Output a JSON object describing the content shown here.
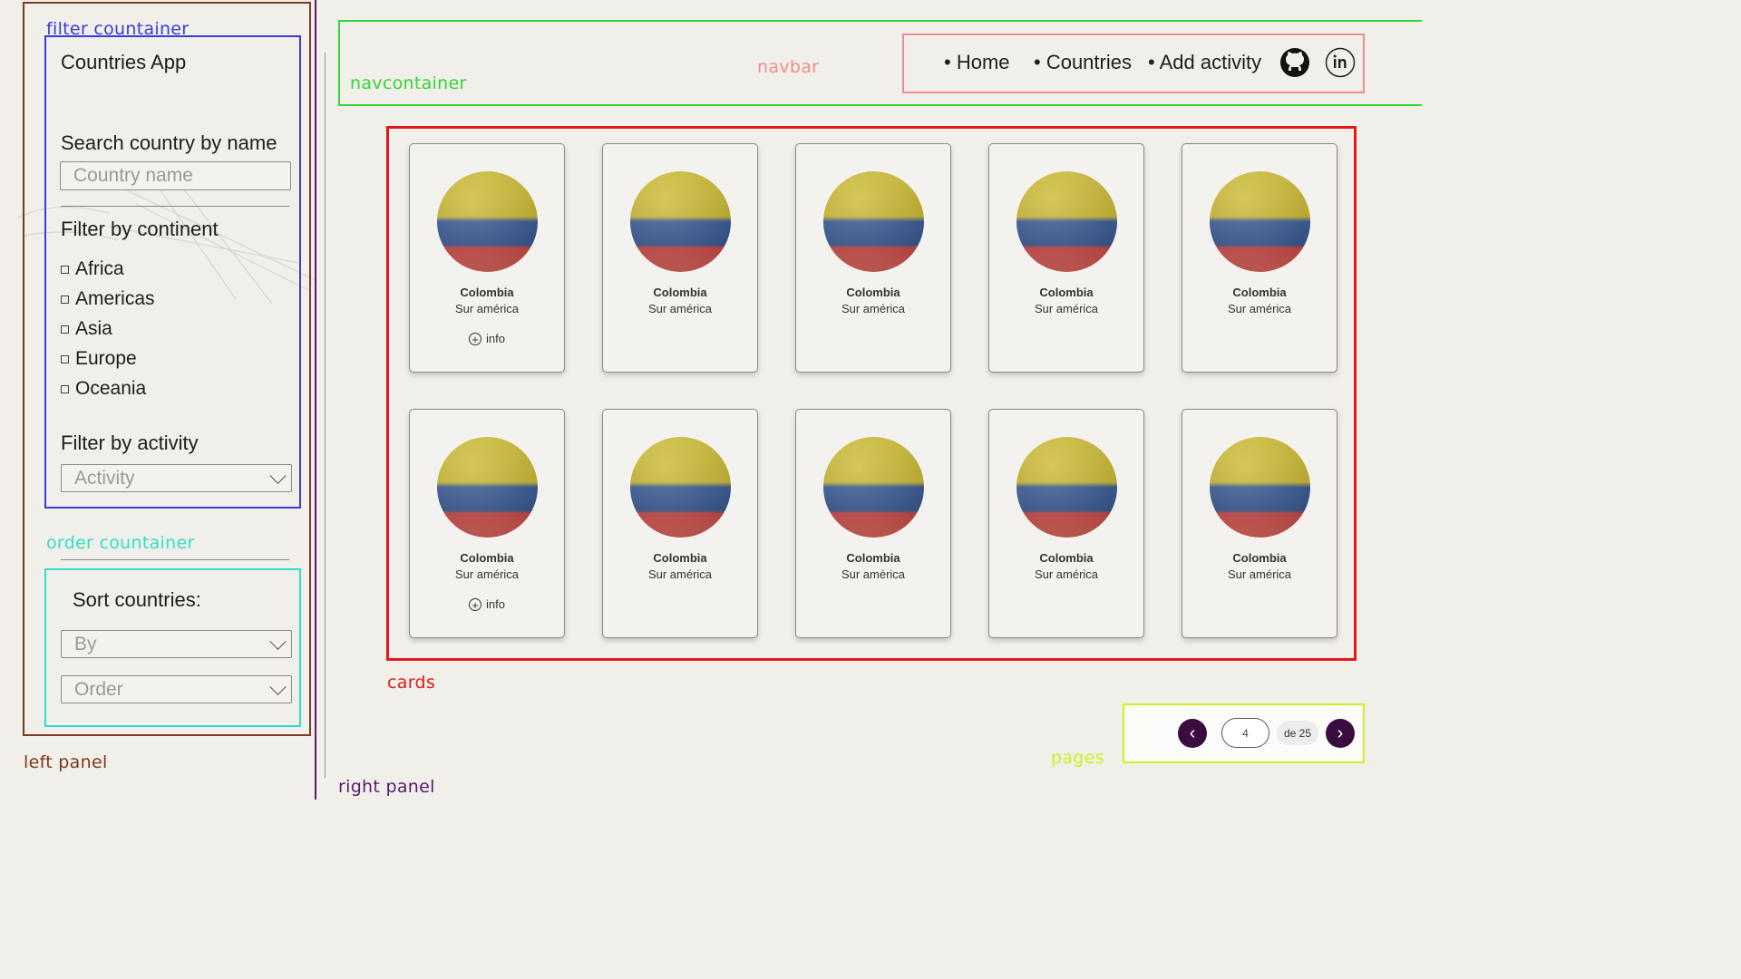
{
  "annotations": {
    "filter_container": "filter countainer",
    "navcontainer": "navcontainer",
    "navbar": "navbar",
    "order_container": "order countainer",
    "cards": "cards",
    "pages": "pages",
    "left_panel": "left panel",
    "right_panel": "right panel"
  },
  "colors": {
    "left_panel": "#7c3a1e",
    "filter_container": "#3b3bd6",
    "order_container": "#2fe0c8",
    "navcontainer": "#33d633",
    "navbar": "#f28c8c",
    "cards": "#e31818",
    "pages": "#d2ee1e",
    "right_panel": "#5a1a6e",
    "page_button": "#3a0c3f"
  },
  "sidebar": {
    "app_title": "Countries App",
    "search_label": "Search country by name",
    "search_placeholder": "Country name",
    "continent_label": "Filter by continent",
    "continents": [
      "Africa",
      "Americas",
      "Asia",
      "Europe",
      "Oceania"
    ],
    "activity_label": "Filter by activity",
    "activity_placeholder": "Activity",
    "sort_label": "Sort countries:",
    "sort_by_placeholder": "By",
    "sort_order_placeholder": "Order"
  },
  "navbar": {
    "items": [
      "Home",
      "Countries",
      "Add activity"
    ],
    "icons": [
      "github-icon",
      "linkedin-icon"
    ]
  },
  "cards": [
    {
      "name": "Colombia",
      "region": "Sur américa",
      "info": "info"
    },
    {
      "name": "Colombia",
      "region": "Sur américa"
    },
    {
      "name": "Colombia",
      "region": "Sur américa"
    },
    {
      "name": "Colombia",
      "region": "Sur américa"
    },
    {
      "name": "Colombia",
      "region": "Sur américa"
    },
    {
      "name": "Colombia",
      "region": "Sur américa",
      "info": "info"
    },
    {
      "name": "Colombia",
      "region": "Sur américa"
    },
    {
      "name": "Colombia",
      "region": "Sur américa"
    },
    {
      "name": "Colombia",
      "region": "Sur américa"
    },
    {
      "name": "Colombia",
      "region": "Sur américa"
    }
  ],
  "pagination": {
    "current": "4",
    "total_text": "de 25",
    "prev_icon": "chevron-left-icon",
    "next_icon": "chevron-right-icon"
  }
}
